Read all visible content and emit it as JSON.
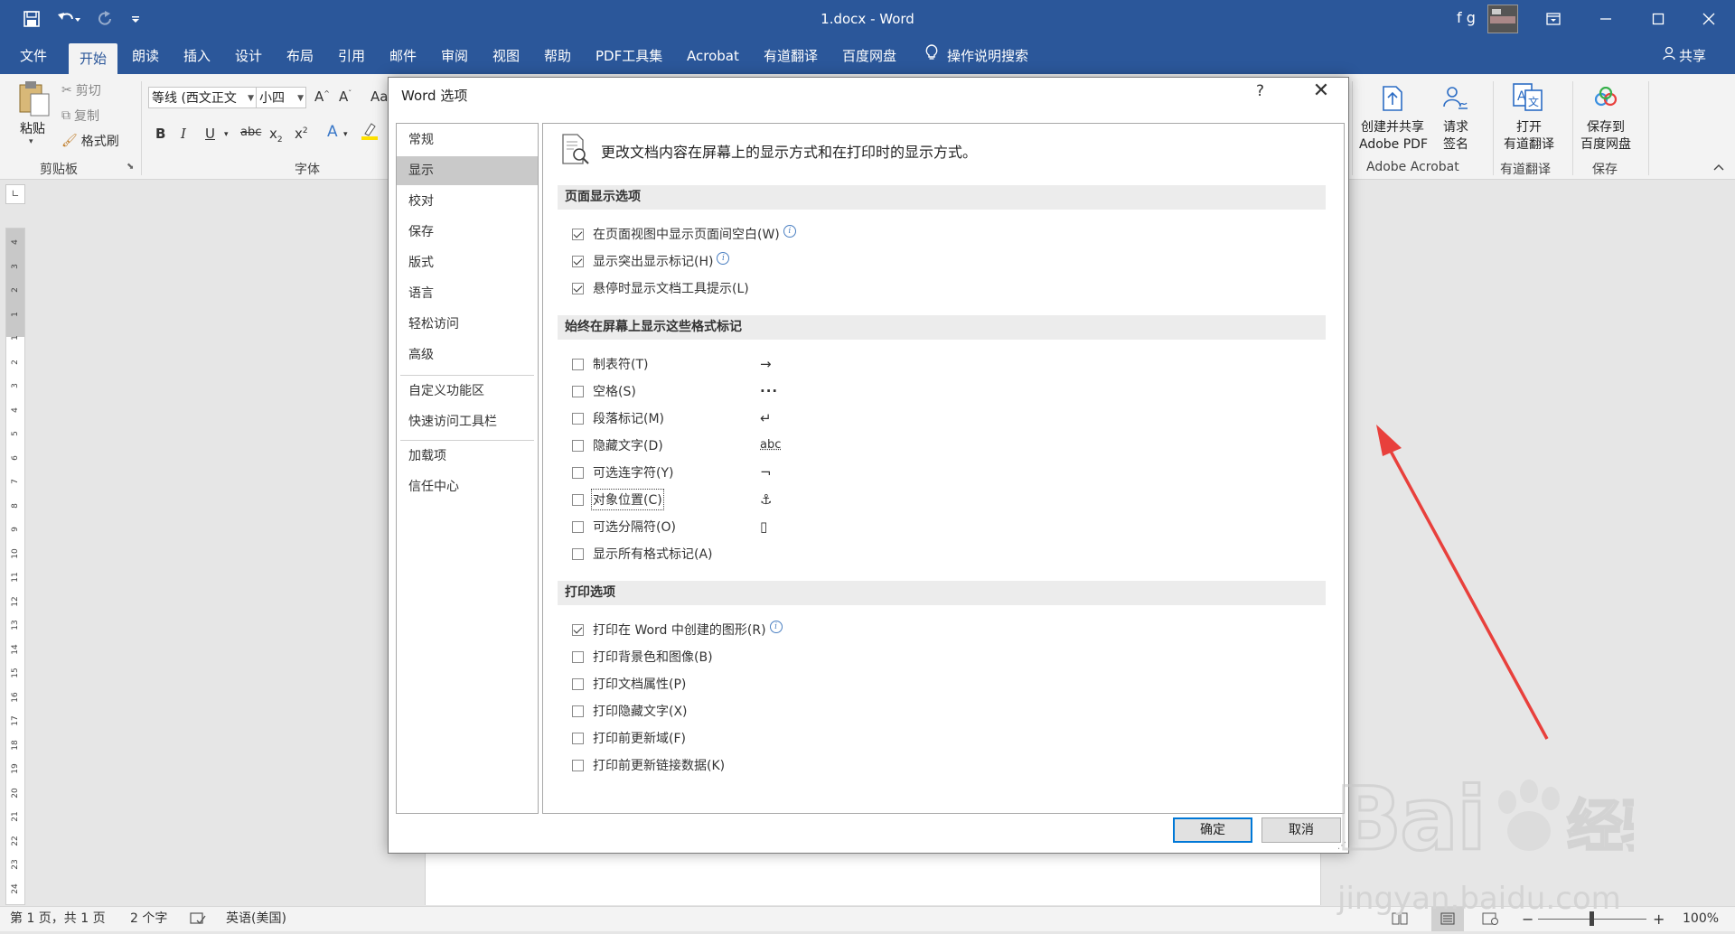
{
  "window": {
    "doc_title": "1.docx  -  Word",
    "user_initials": "f g",
    "colors": {
      "title_bar": "#2b579a",
      "accent": "#2b579a",
      "ribbon_bg": "#f3f3f3",
      "arrow": "#e8403c"
    }
  },
  "quick_access": {
    "icons": [
      "save-icon",
      "undo-icon",
      "redo-icon",
      "customize-icon"
    ]
  },
  "tabs": [
    {
      "label": "文件"
    },
    {
      "label": "开始"
    },
    {
      "label": "朗读"
    },
    {
      "label": "插入"
    },
    {
      "label": "设计"
    },
    {
      "label": "布局"
    },
    {
      "label": "引用"
    },
    {
      "label": "邮件"
    },
    {
      "label": "审阅"
    },
    {
      "label": "视图"
    },
    {
      "label": "帮助"
    },
    {
      "label": "PDF工具集"
    },
    {
      "label": "Acrobat"
    },
    {
      "label": "有道翻译"
    },
    {
      "label": "百度网盘"
    },
    {
      "label": "操作说明搜索"
    }
  ],
  "share_label": "共享",
  "ribbon": {
    "clipboard": {
      "paste": "粘贴",
      "cut": "剪切",
      "copy": "复制",
      "format_painter": "格式刷",
      "group": "剪贴板"
    },
    "font": {
      "font_name": "等线 (西文正文",
      "font_size": "小四",
      "group": "字体",
      "partial_label": "Aa"
    },
    "acrobat": {
      "create_share_l1": "创建并共享",
      "create_share_l2": "Adobe PDF",
      "request_sign_l1": "请求",
      "request_sign_l2": "签名",
      "group": "Adobe Acrobat"
    },
    "youdao": {
      "open_l1": "打开",
      "open_l2": "有道翻译",
      "group": "有道翻译"
    },
    "baidu": {
      "save_l1": "保存到",
      "save_l2": "百度网盘",
      "group": "保存"
    }
  },
  "ruler_numbers": [
    "4",
    "3",
    "2",
    "1",
    "1",
    "2",
    "3",
    "4",
    "5",
    "6",
    "7",
    "8",
    "9",
    "10",
    "11",
    "12",
    "13",
    "14",
    "15",
    "16",
    "17",
    "18",
    "19",
    "20",
    "21",
    "22",
    "23",
    "24"
  ],
  "status": {
    "page": "第 1 页，共 1 页",
    "words": "2 个字",
    "language": "英语(美国)",
    "zoom": "100%",
    "zoom_minus": "−",
    "zoom_plus": "+"
  },
  "dialog": {
    "title": "Word 选项",
    "help": "?",
    "close": "✕",
    "nav_items": [
      "常规",
      "显示",
      "校对",
      "保存",
      "版式",
      "语言",
      "轻松访问",
      "高级"
    ],
    "nav_items_2": [
      "自定义功能区",
      "快速访问工具栏"
    ],
    "nav_items_3": [
      "加载项",
      "信任中心"
    ],
    "selected_nav": "显示",
    "heading": "更改文档内容在屏幕上的显示方式和在打印时的显示方式。",
    "sections": {
      "page_display": {
        "title": "页面显示选项",
        "options": [
          {
            "label": "在页面视图中显示页面间空白(W)",
            "checked": true,
            "info": true
          },
          {
            "label": "显示突出显示标记(H)",
            "checked": true,
            "info": true
          },
          {
            "label": "悬停时显示文档工具提示(L)",
            "checked": true,
            "info": false
          }
        ]
      },
      "format_marks": {
        "title": "始终在屏幕上显示这些格式标记",
        "options": [
          {
            "label": "制表符(T)",
            "checked": false,
            "symbol": "→"
          },
          {
            "label": "空格(S)",
            "checked": false,
            "symbol": "···"
          },
          {
            "label": "段落标记(M)",
            "checked": false,
            "symbol": "↵"
          },
          {
            "label": "隐藏文字(D)",
            "checked": false,
            "symbol": "abc"
          },
          {
            "label": "可选连字符(Y)",
            "checked": false,
            "symbol": "¬"
          },
          {
            "label": "对象位置(C)",
            "checked": false,
            "symbol": "⚓"
          },
          {
            "label": "可选分隔符(O)",
            "checked": false,
            "symbol": "▯"
          },
          {
            "label": "显示所有格式标记(A)",
            "checked": false,
            "symbol": ""
          }
        ]
      },
      "print": {
        "title": "打印选项",
        "options": [
          {
            "label": "打印在 Word 中创建的图形(R)",
            "checked": true,
            "info": true
          },
          {
            "label": "打印背景色和图像(B)",
            "checked": false,
            "info": false
          },
          {
            "label": "打印文档属性(P)",
            "checked": false,
            "info": false
          },
          {
            "label": "打印隐藏文字(X)",
            "checked": false,
            "info": false
          },
          {
            "label": "打印前更新域(F)",
            "checked": false,
            "info": false
          },
          {
            "label": "打印前更新链接数据(K)",
            "checked": false,
            "info": false
          }
        ]
      }
    },
    "ok": "确定",
    "cancel": "取消"
  },
  "watermark": {
    "logo_text": "Bai 经验",
    "url_text": "jingyan.baidu.com"
  }
}
